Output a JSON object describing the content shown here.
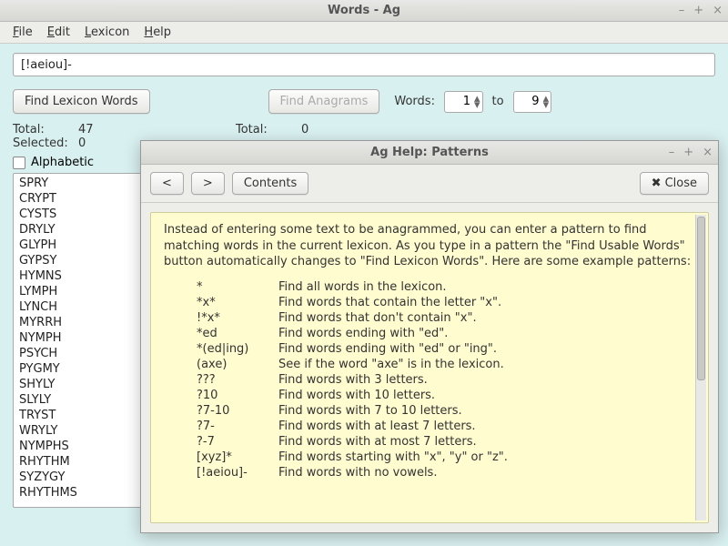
{
  "window": {
    "title": "Words - Ag",
    "controls": {
      "min": "–",
      "max": "+",
      "close": "×"
    }
  },
  "menu": {
    "file": "File",
    "edit": "Edit",
    "lexicon": "Lexicon",
    "help": "Help"
  },
  "search": {
    "value": "[!aeiou]-"
  },
  "buttons": {
    "find_lexicon": "Find Lexicon Words",
    "find_anagrams": "Find Anagrams"
  },
  "words_range": {
    "label": "Words:",
    "from": "1",
    "to_label": "to",
    "to": "9"
  },
  "stats": {
    "left": {
      "total_k": "Total:",
      "total_v": "47",
      "selected_k": "Selected:",
      "selected_v": "0"
    },
    "right": {
      "total_k": "Total:",
      "total_v": "0"
    }
  },
  "alphabetic": {
    "label": "Alphabetic"
  },
  "word_list": [
    "SPRY",
    "CRYPT",
    "CYSTS",
    "DRYLY",
    "GLYPH",
    "GYPSY",
    "HYMNS",
    "LYMPH",
    "LYNCH",
    "MYRRH",
    "NYMPH",
    "PSYCH",
    "PYGMY",
    "SHYLY",
    "SLYLY",
    "TRYST",
    "WRYLY",
    "NYMPHS",
    "RHYTHM",
    "SYZYGY",
    "RHYTHMS"
  ],
  "help": {
    "title": "Ag Help: Patterns",
    "controls": {
      "min": "–",
      "max": "+",
      "close": "×"
    },
    "nav": {
      "back": "<",
      "fwd": ">",
      "contents": "Contents",
      "close": "Close"
    },
    "intro": "Instead of entering some text to be anagrammed, you can enter a pattern to find matching words in the current lexicon. As you type in a pattern the \"Find Usable Words\" button automatically changes to \"Find Lexicon Words\". Here are some example patterns:",
    "rows": [
      {
        "p": "*",
        "d": "Find all words in the lexicon."
      },
      {
        "p": "*x*",
        "d": "Find words that contain the letter \"x\"."
      },
      {
        "p": "!*x*",
        "d": "Find words that don't contain \"x\"."
      },
      {
        "p": "*ed",
        "d": "Find words ending with \"ed\"."
      },
      {
        "p": "*(ed|ing)",
        "d": "Find words ending with \"ed\" or \"ing\"."
      },
      {
        "p": "(axe)",
        "d": "See if the word \"axe\" is in the lexicon."
      },
      {
        "p": "???",
        "d": "Find words with 3 letters."
      },
      {
        "p": "?10",
        "d": "Find words with 10 letters."
      },
      {
        "p": "?7-10",
        "d": "Find words with 7 to 10 letters."
      },
      {
        "p": "?7-",
        "d": "Find words with at least 7 letters."
      },
      {
        "p": "?-7",
        "d": "Find words with at most 7 letters."
      },
      {
        "p": "[xyz]*",
        "d": "Find words starting with \"x\", \"y\" or \"z\"."
      },
      {
        "p": "[!aeiou]-",
        "d": "Find words with no vowels."
      }
    ]
  }
}
